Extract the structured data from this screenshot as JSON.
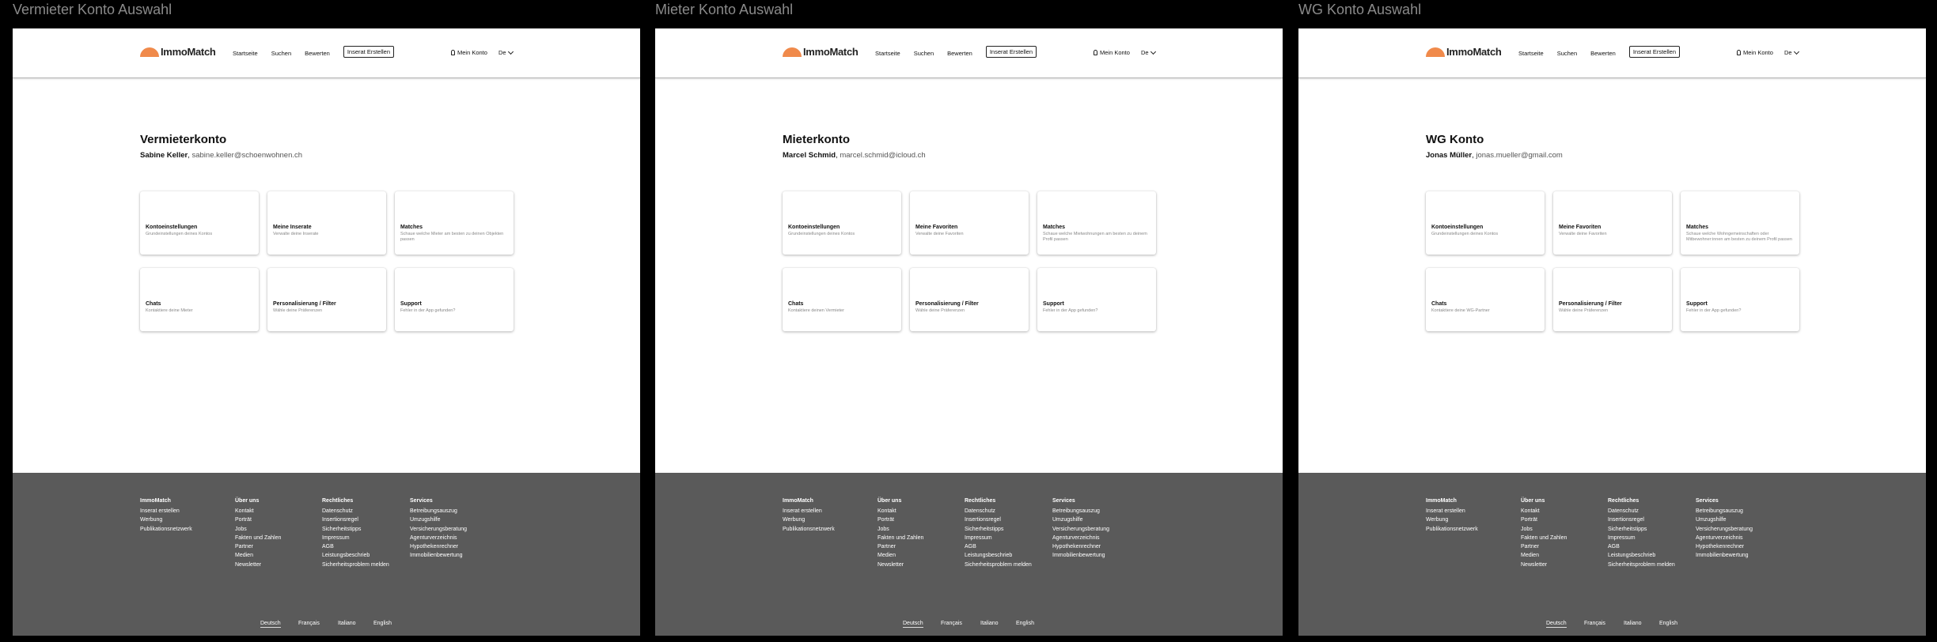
{
  "frames": [
    {
      "frame_title": "Vermieter Konto Auswahl",
      "header": {
        "logo_text": "ImmoMatch",
        "nav": [
          "Startseite",
          "Suchen",
          "Bewerten"
        ],
        "cta": "Inserat Erstellen",
        "account": "Mein Konto",
        "lang": "De"
      },
      "page_title": "Vermieterkonto",
      "user_name": "Sabine Keller",
      "user_email": "sabine.keller@schoenwohnen.ch",
      "cards": [
        {
          "title": "Kontoeinstellungen",
          "desc": "Grundeinstellungen deines Kontos"
        },
        {
          "title": "Meine Inserate",
          "desc": "Verwalte deine Inserate"
        },
        {
          "title": "Matches",
          "desc": "Schaue welche Mieter am besten zu deinen Objekten passen"
        },
        {
          "title": "Chats",
          "desc": "Kontaktiere deine Mieter"
        },
        {
          "title": "Personalisierung / Filter",
          "desc": "Wähle deine Präferenzen"
        },
        {
          "title": "Support",
          "desc": "Fehler in der App gefunden?"
        }
      ]
    },
    {
      "frame_title": "Mieter Konto Auswahl",
      "header": {
        "logo_text": "ImmoMatch",
        "nav": [
          "Startseite",
          "Suchen",
          "Bewerten"
        ],
        "cta": "Inserat Erstellen",
        "account": "Mein Konto",
        "lang": "De"
      },
      "page_title": "Mieterkonto",
      "user_name": "Marcel Schmid",
      "user_email": "marcel.schmid@icloud.ch",
      "cards": [
        {
          "title": "Kontoeinstellungen",
          "desc": "Grundeinstellungen deines Kontos"
        },
        {
          "title": "Meine Favoriten",
          "desc": "Verwalte deine Favoriten"
        },
        {
          "title": "Matches",
          "desc": "Schaue welche Mietwohnungen am besten zu deinem Profil passen"
        },
        {
          "title": "Chats",
          "desc": "Kontaktiere deinen Vermieter"
        },
        {
          "title": "Personalisierung / Filter",
          "desc": "Wähle deine Präferenzen"
        },
        {
          "title": "Support",
          "desc": "Fehler in der App gefunden?"
        }
      ]
    },
    {
      "frame_title": "WG Konto Auswahl",
      "header": {
        "logo_text": "ImmoMatch",
        "nav": [
          "Startseite",
          "Suchen",
          "Bewerten"
        ],
        "cta": "Inserat Erstellen",
        "account": "Mein Konto",
        "lang": "De"
      },
      "page_title": "WG Konto",
      "user_name": "Jonas Müller",
      "user_email": "jonas.mueller@gmail.com",
      "cards": [
        {
          "title": "Kontoeinstellungen",
          "desc": "Grundeinstellungen deines Kontos"
        },
        {
          "title": "Meine Favoriten",
          "desc": "Verwalte deine Favoriten"
        },
        {
          "title": "Matches",
          "desc": "Schaue welche Wohngemeinschaften oder Mitbewohner:innen am besten zu deinem Profil passen"
        },
        {
          "title": "Chats",
          "desc": "Kontaktiere deine WG-Partner"
        },
        {
          "title": "Personalisierung / Filter",
          "desc": "Wähle deine Präferenzen"
        },
        {
          "title": "Support",
          "desc": "Fehler in der App gefunden?"
        }
      ]
    }
  ],
  "footer": {
    "columns": [
      {
        "heading": "ImmoMatch",
        "items": [
          "Inserat erstellen",
          "Werbung",
          "Publikationsnetzwerk"
        ]
      },
      {
        "heading": "Über uns",
        "items": [
          "Kontakt",
          "Porträt",
          "Jobs",
          "Fakten und Zahlen",
          "Partner",
          "Medien",
          "Newsletter"
        ]
      },
      {
        "heading": "Rechtliches",
        "items": [
          "Datenschutz",
          "Insertionsregel",
          "Sicherheitstipps",
          "Impressum",
          "AGB",
          "Leistungsbeschrieb",
          "Sicherheitsproblem melden"
        ]
      },
      {
        "heading": "Services",
        "items": [
          "Betreibungsauszug",
          "Umzugshilfe",
          "Versicherungsberatung",
          "Agenturverzeichnis",
          "Hypothekenrechner",
          "Immobilienbewertung"
        ]
      }
    ],
    "languages": [
      "Deutsch",
      "Français",
      "Italiano",
      "English"
    ],
    "active_language": "Deutsch"
  },
  "colors": {
    "background": "#000000",
    "frame": "#ffffff",
    "footer": "#5a5a5a",
    "logo_accent": "#f08a4b",
    "frame_title": "#8a8a8a"
  }
}
